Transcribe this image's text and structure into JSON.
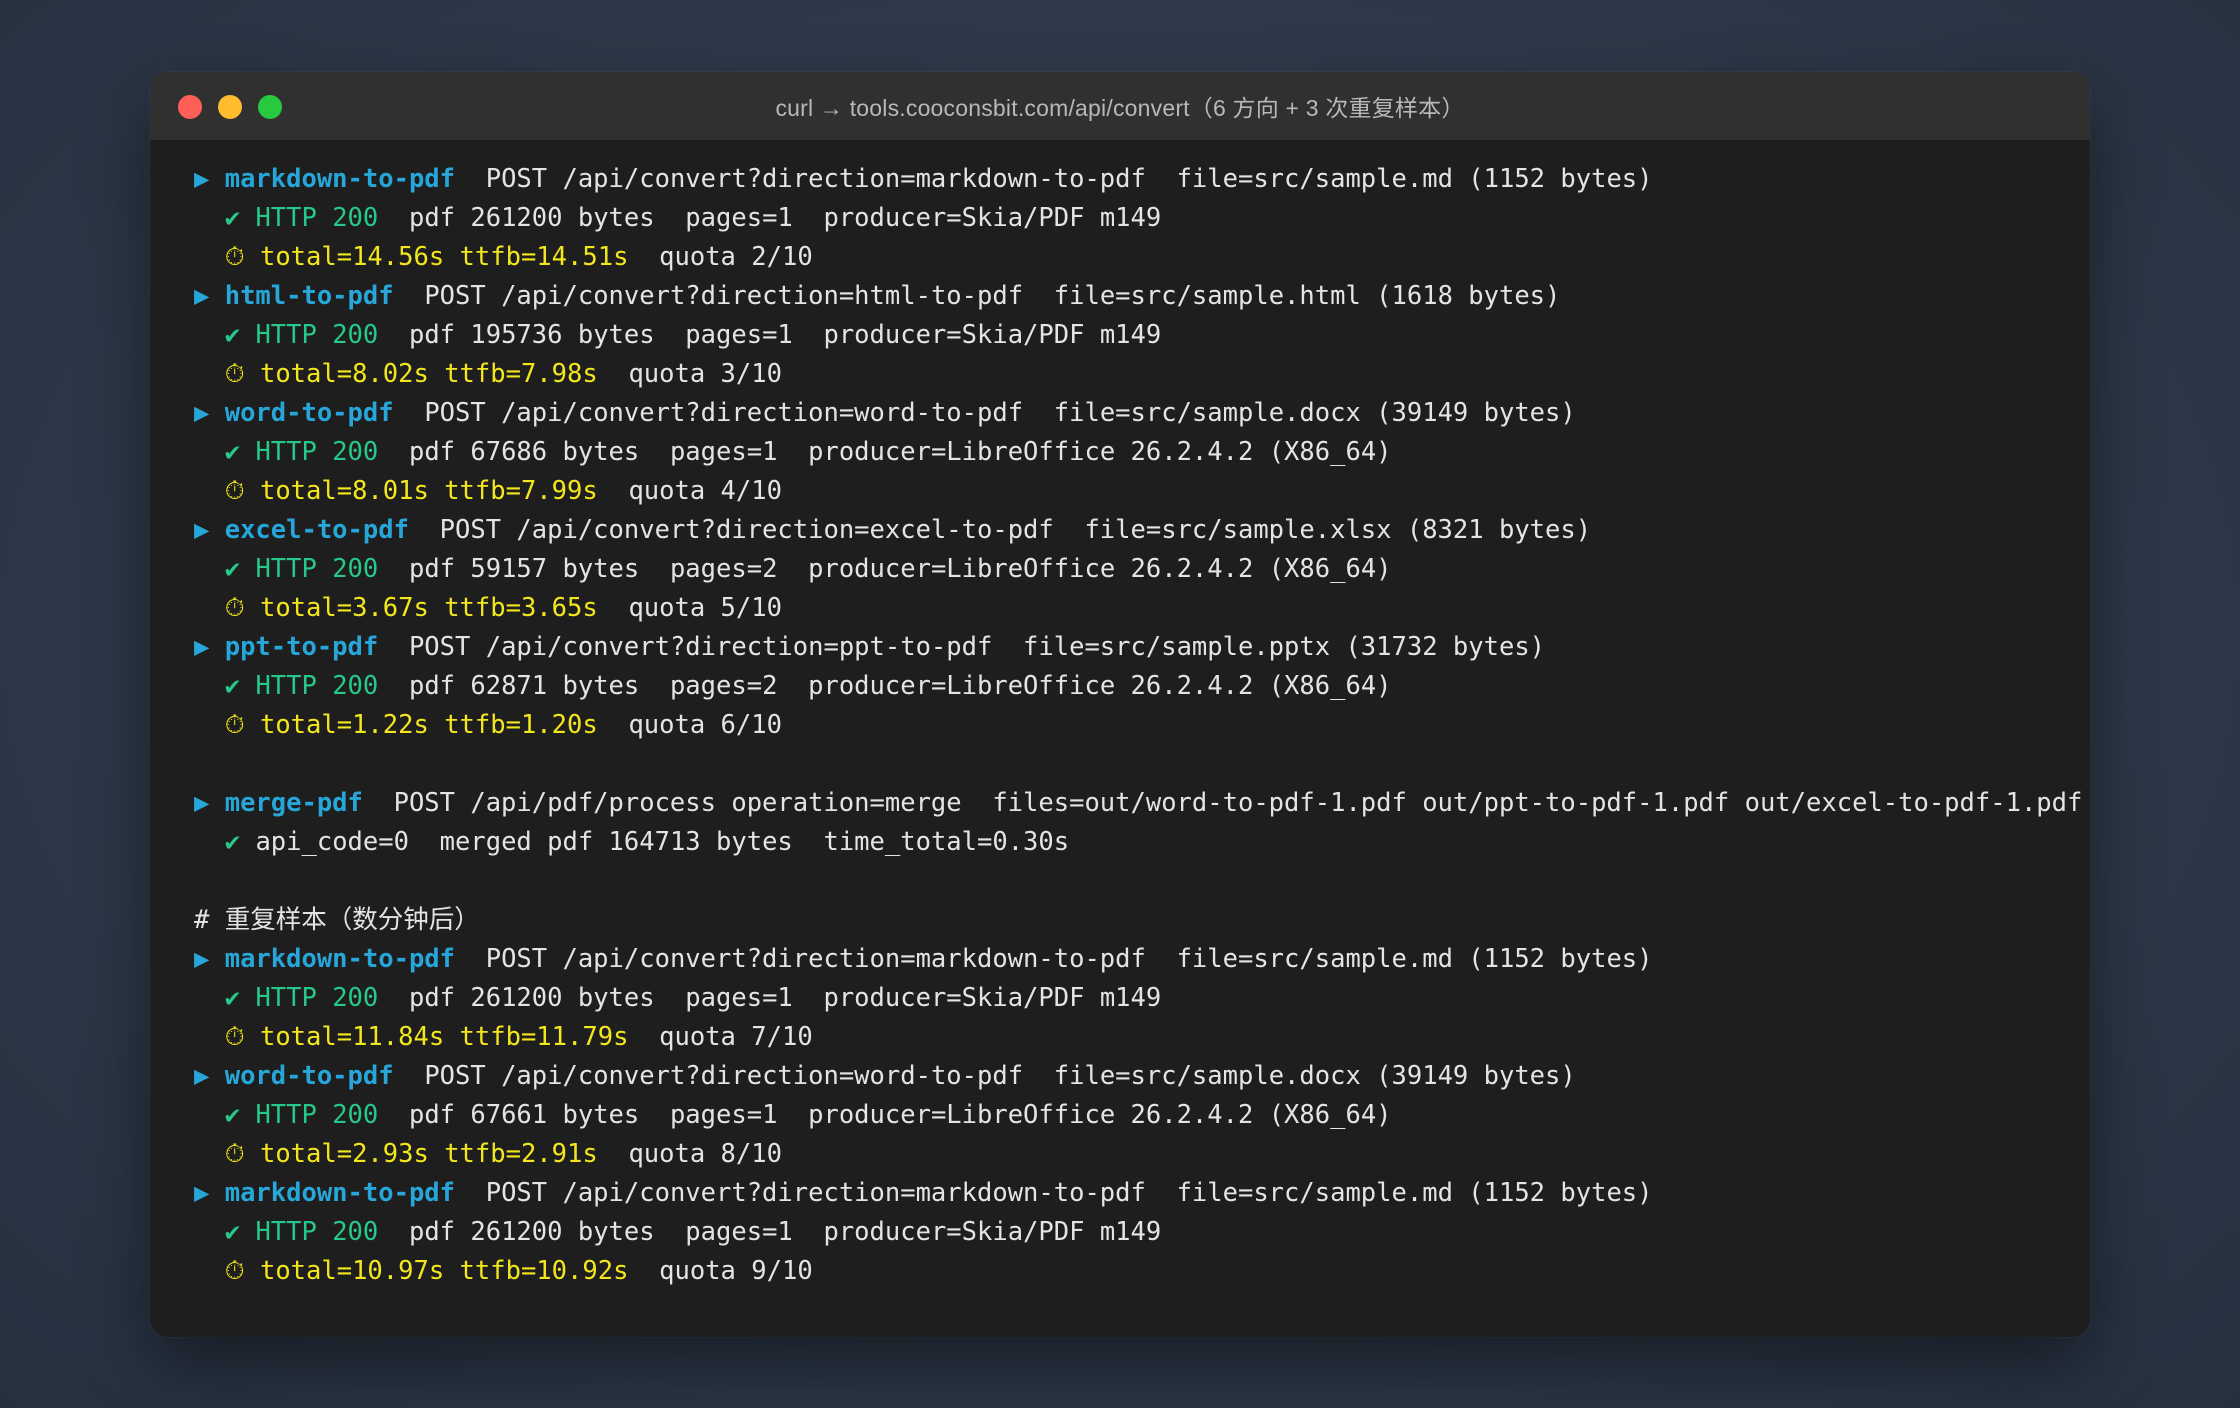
{
  "window": {
    "title": "curl → tools.cooconsbit.com/api/convert（6 方向 + 3 次重复样本）"
  },
  "icons": {
    "run_arrow": "▶",
    "check": "✔",
    "clock": "⏱"
  },
  "colors": {
    "command": "#27a6d9",
    "success": "#27c98b",
    "timing": "#f2e61c",
    "text": "#e4e4e4",
    "background": "#1e1e1e"
  },
  "runs1": [
    {
      "name": "markdown-to-pdf",
      "request": "  POST /api/convert?direction=markdown-to-pdf  file=src/sample.md (1152 bytes)",
      "status": "HTTP 200",
      "result": "  pdf 261200 bytes  pages=1  producer=Skia/PDF m149",
      "timing": "total=14.56s ttfb=14.51s",
      "quota": "  quota 2/10"
    },
    {
      "name": "html-to-pdf",
      "request": "  POST /api/convert?direction=html-to-pdf  file=src/sample.html (1618 bytes)",
      "status": "HTTP 200",
      "result": "  pdf 195736 bytes  pages=1  producer=Skia/PDF m149",
      "timing": "total=8.02s ttfb=7.98s",
      "quota": "  quota 3/10"
    },
    {
      "name": "word-to-pdf",
      "request": "  POST /api/convert?direction=word-to-pdf  file=src/sample.docx (39149 bytes)",
      "status": "HTTP 200",
      "result": "  pdf 67686 bytes  pages=1  producer=LibreOffice 26.2.4.2 (X86_64)",
      "timing": "total=8.01s ttfb=7.99s",
      "quota": "  quota 4/10"
    },
    {
      "name": "excel-to-pdf",
      "request": "  POST /api/convert?direction=excel-to-pdf  file=src/sample.xlsx (8321 bytes)",
      "status": "HTTP 200",
      "result": "  pdf 59157 bytes  pages=2  producer=LibreOffice 26.2.4.2 (X86_64)",
      "timing": "total=3.67s ttfb=3.65s",
      "quota": "  quota 5/10"
    },
    {
      "name": "ppt-to-pdf",
      "request": "  POST /api/convert?direction=ppt-to-pdf  file=src/sample.pptx (31732 bytes)",
      "status": "HTTP 200",
      "result": "  pdf 62871 bytes  pages=2  producer=LibreOffice 26.2.4.2 (X86_64)",
      "timing": "total=1.22s ttfb=1.20s",
      "quota": "  quota 6/10"
    }
  ],
  "merge": {
    "name": "merge-pdf",
    "request": "  POST /api/pdf/process operation=merge  files=out/word-to-pdf-1.pdf out/ppt-to-pdf-1.pdf out/excel-to-pdf-1.pdf",
    "result": "api_code=0  merged pdf 164713 bytes  time_total=0.30s"
  },
  "comment": "# 重复样本（数分钟后）",
  "runs2": [
    {
      "name": "markdown-to-pdf",
      "request": "  POST /api/convert?direction=markdown-to-pdf  file=src/sample.md (1152 bytes)",
      "status": "HTTP 200",
      "result": "  pdf 261200 bytes  pages=1  producer=Skia/PDF m149",
      "timing": "total=11.84s ttfb=11.79s",
      "quota": "  quota 7/10"
    },
    {
      "name": "word-to-pdf",
      "request": "  POST /api/convert?direction=word-to-pdf  file=src/sample.docx (39149 bytes)",
      "status": "HTTP 200",
      "result": "  pdf 67661 bytes  pages=1  producer=LibreOffice 26.2.4.2 (X86_64)",
      "timing": "total=2.93s ttfb=2.91s",
      "quota": "  quota 8/10"
    },
    {
      "name": "markdown-to-pdf",
      "request": "  POST /api/convert?direction=markdown-to-pdf  file=src/sample.md (1152 bytes)",
      "status": "HTTP 200",
      "result": "  pdf 261200 bytes  pages=1  producer=Skia/PDF m149",
      "timing": "total=10.97s ttfb=10.92s",
      "quota": "  quota 9/10"
    }
  ]
}
